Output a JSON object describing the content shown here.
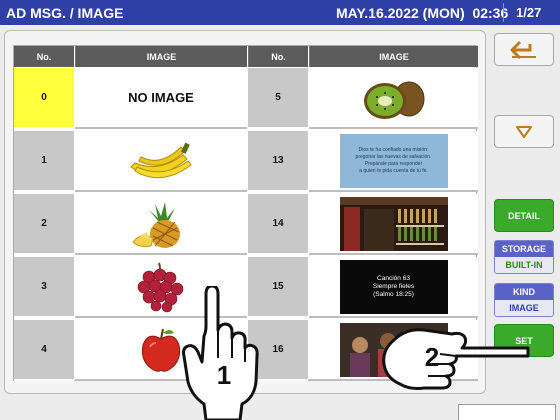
{
  "titlebar": {
    "title": "AD MSG. / IMAGE",
    "date": "MAY.16.2022 (MON)",
    "time": "02:36",
    "page": "1/27"
  },
  "table": {
    "left_headers": {
      "no": "No.",
      "image": "IMAGE"
    },
    "right_headers": {
      "no": "No.",
      "image": "IMAGE"
    },
    "left_rows": [
      {
        "no": "0",
        "image_label": "NO IMAGE",
        "image": "none",
        "selected": true
      },
      {
        "no": "1",
        "image": "banana-image"
      },
      {
        "no": "2",
        "image": "pineapple-image"
      },
      {
        "no": "3",
        "image": "grapes-image"
      },
      {
        "no": "4",
        "image": "apple-image"
      }
    ],
    "right_rows": [
      {
        "no": "5",
        "image": "kiwi-image"
      },
      {
        "no": "13",
        "image": "verse-text-image",
        "lines": [
          "Dios te ha confiado una misión:",
          "pregonar las nuevas de salvación.",
          "Prepárate para responder",
          "a quien te pida cuenta de tu fe."
        ]
      },
      {
        "no": "14",
        "image": "wine-shop-image"
      },
      {
        "no": "15",
        "image": "song-text-image",
        "lines": [
          "Canción 63",
          "Siempre fieles",
          "(Salmo 18:25)"
        ]
      },
      {
        "no": "16",
        "image": "people-photo-image"
      }
    ]
  },
  "side": {
    "detail_label": "DETAIL",
    "storage_label": "STORAGE",
    "storage_value": "BUILT-IN",
    "kind_label": "KIND",
    "kind_value": "IMAGE",
    "set_label": "SET"
  },
  "annotations": {
    "step1": "1",
    "step2": "2"
  }
}
